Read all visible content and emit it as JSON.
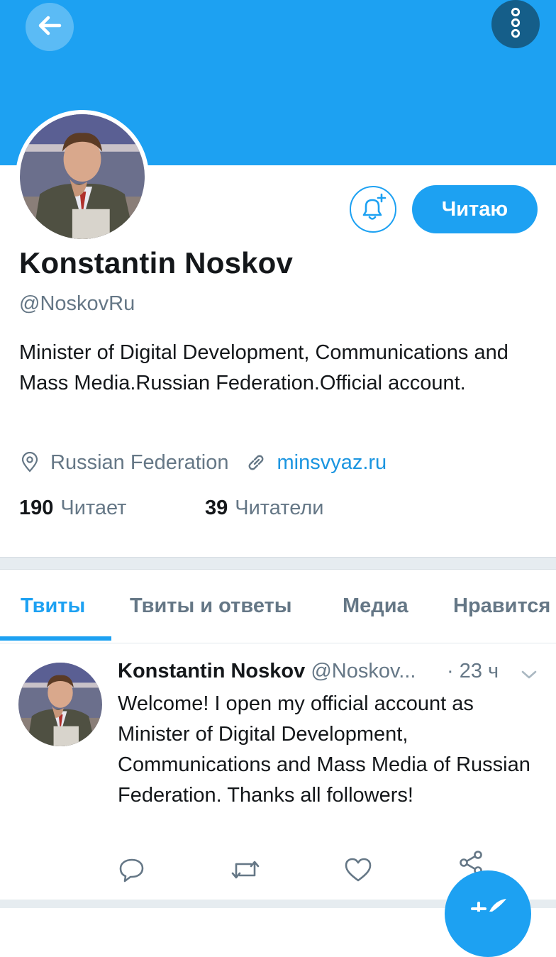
{
  "colors": {
    "accent": "#1da1f2",
    "banner": "#1da1f2",
    "text": "#14171a",
    "secondary": "#657786",
    "link": "#1b95e0"
  },
  "header": {
    "back_icon": "arrow-left-icon",
    "more_icon": "more-vertical-icon"
  },
  "profile": {
    "name": "Konstantin Noskov",
    "handle": "@NoskovRu",
    "bio": "Minister of Digital Development, Communications and Mass Media.Russian Federation.Official account.",
    "location": "Russian Federation",
    "url": "minsvyaz.ru",
    "follow_label": "Читаю",
    "notifications_icon": "bell-plus-icon"
  },
  "stats": {
    "following_count": "190",
    "following_label": "Читает",
    "followers_count": "39",
    "followers_label": "Читатели"
  },
  "tabs": [
    {
      "label": "Твиты",
      "active": true
    },
    {
      "label": "Твиты и ответы",
      "active": false
    },
    {
      "label": "Медиа",
      "active": false
    },
    {
      "label": "Нравится",
      "active": false
    }
  ],
  "tweet": {
    "author": "Konstantin Noskov",
    "handle": "@Noskov...",
    "time": "· 23 ч",
    "text": "Welcome!  I open my official account as Minister of Digital Development, Communications and Mass Media of Russian Federation. Thanks all followers!",
    "actions": [
      "reply-icon",
      "retweet-icon",
      "like-icon",
      "share-icon"
    ]
  },
  "fab": {
    "icon": "compose-icon"
  }
}
